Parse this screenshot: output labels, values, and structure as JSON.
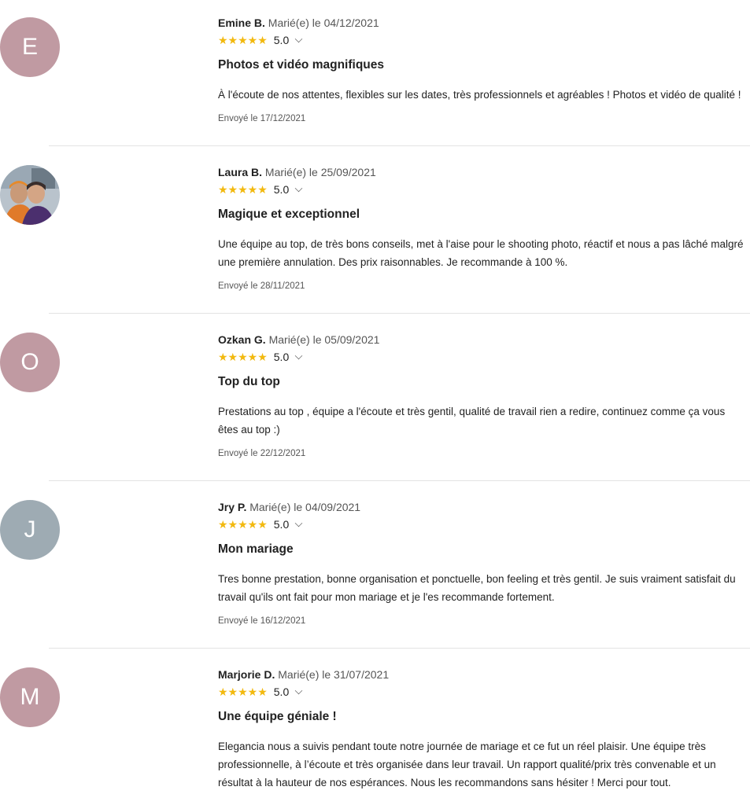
{
  "reviews": [
    {
      "initial": "E",
      "avatar_color": "#c09aa2",
      "author": "Emine B.",
      "married": "Marié(e) le 04/12/2021",
      "stars": "★★★★★",
      "score": "5.0",
      "title": "Photos et vidéo magnifiques",
      "body": "À l'écoute de nos attentes, flexibles sur les dates, très professionnels et agréables ! Photos et vidéo de qualité !",
      "sent": "Envoyé le 17/12/2021"
    },
    {
      "initial": "",
      "avatar_color": "#5a4a6e",
      "author": "Laura B.",
      "married": "Marié(e) le 25/09/2021",
      "stars": "★★★★★",
      "score": "5.0",
      "title": "Magique et exceptionnel",
      "body": "Une équipe au top, de très bons conseils, met à l'aise pour le shooting photo, réactif et nous a pas lâché malgré une première annulation. Des prix raisonnables. Je recommande à 100 %.",
      "sent": "Envoyé le 28/11/2021"
    },
    {
      "initial": "O",
      "avatar_color": "#c09aa2",
      "author": "Ozkan G.",
      "married": "Marié(e) le 05/09/2021",
      "stars": "★★★★★",
      "score": "5.0",
      "title": "Top du top",
      "body": "Prestations au top , équipe a l'écoute et très gentil, qualité de travail rien a redire, continuez comme ça vous êtes au top :)",
      "sent": "Envoyé le 22/12/2021"
    },
    {
      "initial": "J",
      "avatar_color": "#9eabb3",
      "author": "Jry P.",
      "married": "Marié(e) le 04/09/2021",
      "stars": "★★★★★",
      "score": "5.0",
      "title": "Mon mariage",
      "body": "Tres bonne prestation, bonne organisation et ponctuelle, bon feeling et très gentil. Je suis vraiment satisfait du travail qu'ils ont fait pour mon mariage et je l'es recommande fortement.",
      "sent": "Envoyé le 16/12/2021"
    },
    {
      "initial": "M",
      "avatar_color": "#c09aa2",
      "author": "Marjorie D.",
      "married": "Marié(e) le 31/07/2021",
      "stars": "★★★★★",
      "score": "5.0",
      "title": "Une équipe géniale !",
      "body": "Elegancia nous a suivis pendant toute notre journée de mariage et ce fut un réel plaisir. Une équipe très professionnelle, à l’écoute et très organisée dans leur travail. Un rapport qualité/prix très convenable et un résultat à la hauteur de nos espérances. Nous les recommandons sans hésiter ! Merci pour tout.",
      "sent": ""
    }
  ]
}
